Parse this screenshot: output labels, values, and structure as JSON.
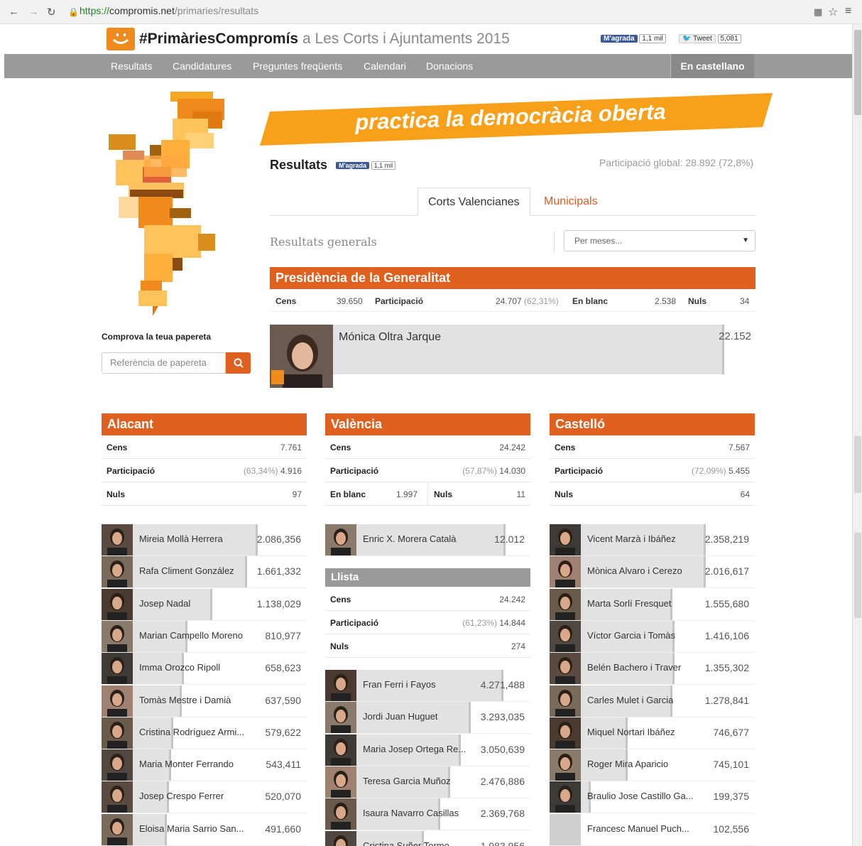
{
  "browser": {
    "url_scheme": "https://",
    "url_host": "compromis.net",
    "url_path": "/primaries/resultats"
  },
  "header": {
    "brand_bold": "#PrimàriesCompromís",
    "brand_rest": "a Les Corts i Ajuntaments 2015",
    "fb_label": "M'agrada",
    "fb_count": "1,1 mil",
    "tw_label": "Tweet",
    "tw_count": "5,081"
  },
  "menu": {
    "items": [
      "Resultats",
      "Candidatures",
      "Preguntes freqüents",
      "Calendari",
      "Donacions"
    ],
    "lang": "En castellano"
  },
  "banner": {
    "text": "practica la democràcia oberta"
  },
  "results": {
    "title": "Resultats",
    "fb_label": "M'agrada",
    "fb_count": "1,1 mil",
    "global": "Participació global: 28.892 (72,8%)"
  },
  "tabs": [
    "Corts Valencianes",
    "Municipals"
  ],
  "general": {
    "label": "Resultats generals",
    "select": "Per meses..."
  },
  "presidencia": {
    "title": "Presidència de la Generalitat",
    "cens_label": "Cens",
    "cens": "39.650",
    "part_label": "Participació",
    "part": "24.707",
    "part_pct": "(62,31%)",
    "blanc_label": "En blanc",
    "blanc": "2.538",
    "nuls_label": "Nuls",
    "nuls": "34",
    "candidate": "Mónica Oltra Jarque",
    "votes": "22.152"
  },
  "check": {
    "title": "Comprova la teua papereta",
    "placeholder": "Referència de papereta"
  },
  "colors": {
    "accent": "#e0601f",
    "orange": "#f08a1c"
  },
  "alacant": {
    "title": "Alacant",
    "cens": "7.761",
    "part_pct": "(63,34%)",
    "part": "4.916",
    "nuls": "97",
    "candidates": [
      {
        "name": "Mireia Mollà Herrera",
        "votes": "2.086,356",
        "share": 0.76
      },
      {
        "name": "Rafa Climent González",
        "votes": "1.661,332",
        "share": 0.71
      },
      {
        "name": "Josep Nadal",
        "votes": "1.138,029",
        "share": 0.54
      },
      {
        "name": "Marian Campello Moreno",
        "votes": "810,977",
        "share": 0.42
      },
      {
        "name": "Imma Orozco Ripoll",
        "votes": "658,623",
        "share": 0.4
      },
      {
        "name": "Tomàs Mestre i Damià",
        "votes": "637,590",
        "share": 0.39
      },
      {
        "name": "Cristina Rodríguez Armi...",
        "votes": "579,622",
        "share": 0.35
      },
      {
        "name": "Maria Monter Ferrando",
        "votes": "543,411",
        "share": 0.34
      },
      {
        "name": "Josep Crespo Ferrer",
        "votes": "520,070",
        "share": 0.33
      },
      {
        "name": "Eloisa Maria Sarrio San...",
        "votes": "491,660",
        "share": 0.32
      }
    ]
  },
  "valencia": {
    "title": "València",
    "cens": "24.242",
    "part_pct": "(57,87%)",
    "part": "14.030",
    "blanc": "1.997",
    "nuls": "11",
    "candidate": {
      "name": "Enric X. Morera Català",
      "votes": "12.012",
      "share": 0.88
    },
    "llista": {
      "title": "Llista",
      "cens": "24.242",
      "part_pct": "(61,23%)",
      "part": "14.844",
      "nuls": "274"
    },
    "candidates": [
      {
        "name": "Fran Ferri i Fayos",
        "votes": "4.271,488",
        "share": 0.87
      },
      {
        "name": "Jordi Juan Huguet",
        "votes": "3.293,035",
        "share": 0.71
      },
      {
        "name": "Maria Josep Ortega Re...",
        "votes": "3.050,639",
        "share": 0.66
      },
      {
        "name": "Teresa Garcia Muñoz",
        "votes": "2.476,886",
        "share": 0.61
      },
      {
        "name": "Isaura Navarro Casillas",
        "votes": "2.369,768",
        "share": 0.56
      },
      {
        "name": "Cristina Suñer Tormo",
        "votes": "1.983,956",
        "share": 0.48
      }
    ]
  },
  "castello": {
    "title": "Castelló",
    "cens": "7.567",
    "part_pct": "(72,09%)",
    "part": "5.455",
    "nuls": "64",
    "candidates": [
      {
        "name": "Vicent Marzà i Ibáñez",
        "votes": "2.358,219",
        "share": 0.76
      },
      {
        "name": "Mònica Alvaro i Cerezo",
        "votes": "2.016,617",
        "share": 0.76
      },
      {
        "name": "Marta Sorlí Fresquet",
        "votes": "1.555,680",
        "share": 0.6
      },
      {
        "name": "Víctor Garcia i Tomàs",
        "votes": "1.416,106",
        "share": 0.61
      },
      {
        "name": "Belén Bachero i Traver",
        "votes": "1.355,302",
        "share": 0.61
      },
      {
        "name": "Carles Mulet i Garcia",
        "votes": "1.278,841",
        "share": 0.6
      },
      {
        "name": "Miquel Nortari Ibáñez",
        "votes": "746,677",
        "share": 0.38
      },
      {
        "name": "Roger Mira Aparicio",
        "votes": "745,101",
        "share": 0.38
      },
      {
        "name": "Braulio Jose Castillo Ga...",
        "votes": "199,375",
        "share": 0.2
      },
      {
        "name": "Francesc Manuel Puch...",
        "votes": "102,556",
        "share": 0.15
      }
    ]
  }
}
